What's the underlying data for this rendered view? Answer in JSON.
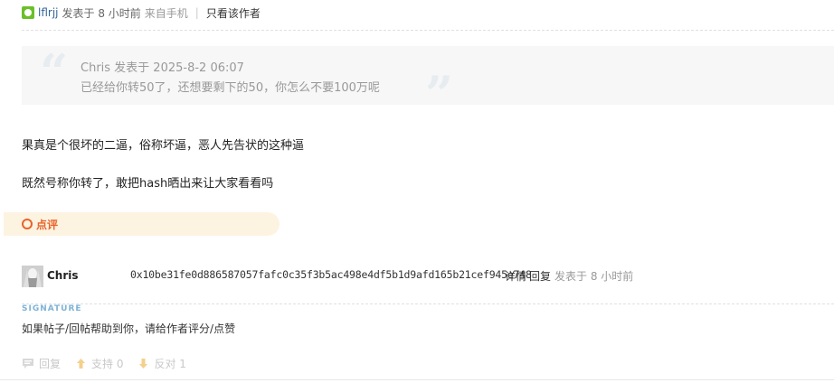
{
  "header": {
    "author": "lflrjj",
    "posted_time": "发表于 8 小时前",
    "source": "来自手机",
    "separator": "|",
    "only_author": "只看该作者"
  },
  "quote": {
    "meta": "Chris 发表于 2025-8-2 06:07",
    "text": "已经给你转50了，还想要剩下的50，你怎么不要100万呢",
    "open_mark": "“",
    "close_mark": "”"
  },
  "body": {
    "line1": "果真是个很坏的二逼，俗称坏逼，恶人先告状的这种逼",
    "line2": "既然号称你转了，敢把hash晒出来让大家看看吗"
  },
  "comment": {
    "label": "点评"
  },
  "reply": {
    "author": "Chris",
    "content": "0x10be31fe0d886587057fafc0c35f3b5ac498e4df5b1d9afd165b21cef945e748",
    "detail_link": "详情",
    "reply_link": "回复",
    "time": "发表于 8 小时前"
  },
  "signature": {
    "title": "SIGNATURE",
    "text": "如果帖子/回帖帮助到你，请给作者评分/点赞"
  },
  "actions": {
    "reply": "回复",
    "support": "支持 0",
    "oppose": "反对 1"
  },
  "colors": {
    "accent": "#e8632b",
    "comment_bg": "#fdf3e1",
    "online_icon": "#6bbf2a",
    "signature_title": "#7fb3d5"
  },
  "icons": {
    "online": "online-status-icon",
    "comment": "ring-icon",
    "reply": "speech-bubble-icon",
    "support": "thumbs-up-icon",
    "oppose": "thumbs-down-icon"
  }
}
